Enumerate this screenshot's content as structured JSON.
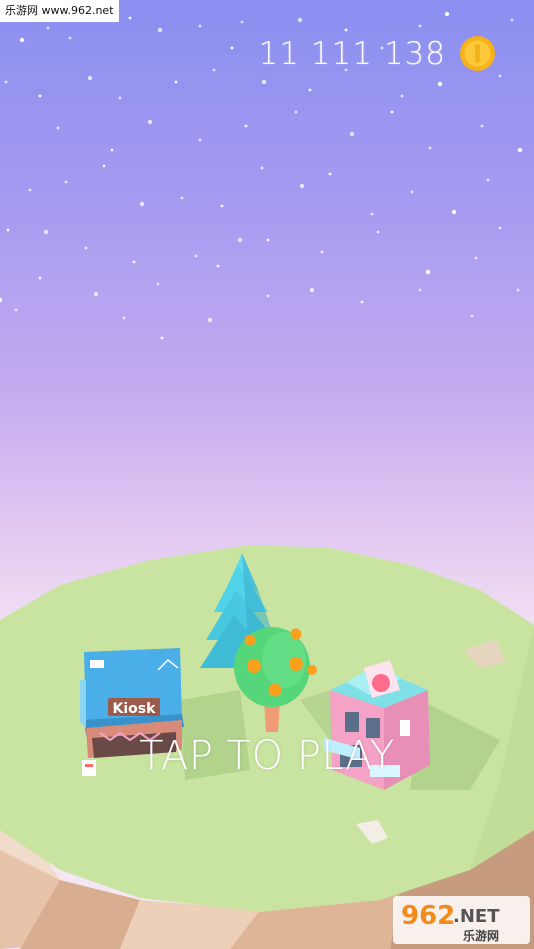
{
  "watermark": {
    "site": "乐游网 www.962.net",
    "logo_main": "962",
    "logo_suffix": ".NET",
    "logo_sub": "乐游网"
  },
  "hud": {
    "coins": "11 111 138",
    "coin_icon": "coin-icon"
  },
  "island": {
    "kiosk_sign": "Kiosk"
  },
  "prompt": {
    "label": "TAP TO PLAY"
  },
  "colors": {
    "sky_top": "#8a8ff0",
    "sky_bottom": "#f4e9f4",
    "grass": "#c9e4a0",
    "coin": "#f6b21a",
    "tree_blue": "#4fd3e8",
    "kiosk_roof": "#4aaee8",
    "shop_pink": "#f4a3c6"
  }
}
